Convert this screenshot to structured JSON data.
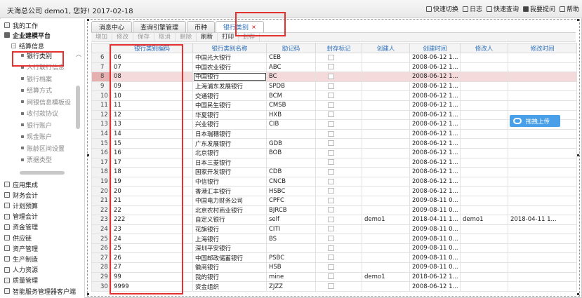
{
  "header": {
    "greeting": "天海总公司 demo1, 您好! 2017-02-18",
    "links": [
      {
        "icon": "quick-switch-icon",
        "label": "快速切换"
      },
      {
        "icon": "log-icon",
        "label": "日志"
      },
      {
        "icon": "quick-query-icon",
        "label": "快速查询"
      },
      {
        "icon": "ask-question-icon",
        "label": "我要提问"
      },
      {
        "icon": "help-icon",
        "label": "帮助"
      }
    ]
  },
  "sidebar": {
    "my_work": "我的工作",
    "enterprise": "企业建模平台",
    "settlement": "结算信息",
    "settlement_items": [
      "银行类别",
      "人行联行信息",
      "银行档案",
      "结算方式",
      "网银信息模板设",
      "收付款协议",
      "银行账户",
      "现金账户",
      "账龄区间设置",
      "票据类型"
    ],
    "active_item": "银行类别",
    "modules": [
      "应用集成",
      "财务会计",
      "计划预算",
      "管理会计",
      "资金管理",
      "供应链",
      "资产管理",
      "生产制造",
      "人力资源",
      "质量管理",
      "智能服务管理器客户端"
    ]
  },
  "tabs": [
    {
      "label": "消息中心"
    },
    {
      "label": "查询引擎管理"
    },
    {
      "label": "币种"
    },
    {
      "label": "银行类别",
      "close": "×"
    }
  ],
  "toolbar": [
    "增加",
    "修改",
    "保存",
    "取消",
    "删除",
    "刷新",
    "打印",
    "封存"
  ],
  "toolbar_enabled": [
    false,
    false,
    false,
    false,
    false,
    true,
    true,
    false
  ],
  "table": {
    "columns": [
      "",
      "银行类别编码",
      "银行类别名称",
      "助记码",
      "封存标记",
      "创建人",
      "创建时间",
      "修改人",
      "修改时间"
    ],
    "selected_row": 8,
    "rows": [
      {
        "n": "6",
        "code": "06",
        "name": "中国光大银行",
        "mnem": "CEB",
        "creator": "",
        "ctime": "2008-06-12 1...",
        "modifier": "",
        "mtime": ""
      },
      {
        "n": "7",
        "code": "07",
        "name": "中国农业银行",
        "mnem": "ABC",
        "creator": "",
        "ctime": "2008-06-12 1...",
        "modifier": "",
        "mtime": ""
      },
      {
        "n": "8",
        "code": "08",
        "name": "中国银行",
        "mnem": "BC",
        "creator": "",
        "ctime": "2008-06-12 1...",
        "modifier": "",
        "mtime": ""
      },
      {
        "n": "9",
        "code": "09",
        "name": "上海浦东发展银行",
        "mnem": "SPDB",
        "creator": "",
        "ctime": "2008-06-12 1...",
        "modifier": "",
        "mtime": ""
      },
      {
        "n": "10",
        "code": "10",
        "name": "交通银行",
        "mnem": "BCM",
        "creator": "",
        "ctime": "2008-06-12 1...",
        "modifier": "",
        "mtime": ""
      },
      {
        "n": "11",
        "code": "11",
        "name": "中国民生银行",
        "mnem": "CMSB",
        "creator": "",
        "ctime": "2008-06-12 1...",
        "modifier": "",
        "mtime": ""
      },
      {
        "n": "12",
        "code": "12",
        "name": "华夏银行",
        "mnem": "HXB",
        "creator": "",
        "ctime": "2008-06-12 1...",
        "modifier": "",
        "mtime": ""
      },
      {
        "n": "13",
        "code": "13",
        "name": "兴业银行",
        "mnem": "CIB",
        "creator": "",
        "ctime": "2008-06-12 1...",
        "modifier": "",
        "mtime": ""
      },
      {
        "n": "14",
        "code": "14",
        "name": "日本瑞穗银行",
        "mnem": "",
        "creator": "",
        "ctime": "2008-06-12 1...",
        "modifier": "",
        "mtime": ""
      },
      {
        "n": "15",
        "code": "15",
        "name": "广东发展银行",
        "mnem": "GDB",
        "creator": "",
        "ctime": "2008-06-12 1...",
        "modifier": "",
        "mtime": ""
      },
      {
        "n": "16",
        "code": "16",
        "name": "北京银行",
        "mnem": "BOB",
        "creator": "",
        "ctime": "2008-06-12 1...",
        "modifier": "",
        "mtime": ""
      },
      {
        "n": "17",
        "code": "17",
        "name": "日本三菱银行",
        "mnem": "",
        "creator": "",
        "ctime": "2008-06-12 1...",
        "modifier": "",
        "mtime": ""
      },
      {
        "n": "18",
        "code": "18",
        "name": "国家开发银行",
        "mnem": "CDB",
        "creator": "",
        "ctime": "2008-06-12 1...",
        "modifier": "",
        "mtime": ""
      },
      {
        "n": "19",
        "code": "19",
        "name": "中信银行",
        "mnem": "CNCB",
        "creator": "",
        "ctime": "2008-06-12 1...",
        "modifier": "",
        "mtime": ""
      },
      {
        "n": "20",
        "code": "20",
        "name": "香港汇丰银行",
        "mnem": "HSBC",
        "creator": "",
        "ctime": "2008-06-12 1...",
        "modifier": "",
        "mtime": ""
      },
      {
        "n": "21",
        "code": "21",
        "name": "中国电力财务公司",
        "mnem": "CPFC",
        "creator": "",
        "ctime": "2009-08-11 0...",
        "modifier": "",
        "mtime": ""
      },
      {
        "n": "22",
        "code": "22",
        "name": "北京农村商业银行",
        "mnem": "BJRCB",
        "creator": "",
        "ctime": "2009-08-11 0...",
        "modifier": "",
        "mtime": ""
      },
      {
        "n": "23",
        "code": "222",
        "name": "自定义银行",
        "mnem": "self",
        "creator": "demo1",
        "ctime": "2018-04-11 1...",
        "modifier": "demo1",
        "mtime": "2018-04-11 1..."
      },
      {
        "n": "24",
        "code": "23",
        "name": "花旗银行",
        "mnem": "CITI",
        "creator": "",
        "ctime": "2009-08-11 0...",
        "modifier": "",
        "mtime": ""
      },
      {
        "n": "25",
        "code": "24",
        "name": "上海银行",
        "mnem": "BS",
        "creator": "",
        "ctime": "2009-08-11 0...",
        "modifier": "",
        "mtime": ""
      },
      {
        "n": "26",
        "code": "25",
        "name": "深圳平安银行",
        "mnem": "",
        "creator": "",
        "ctime": "2009-08-11 0...",
        "modifier": "",
        "mtime": ""
      },
      {
        "n": "27",
        "code": "26",
        "name": "中国邮政储蓄银行",
        "mnem": "PSBC",
        "creator": "",
        "ctime": "2009-08-11 0...",
        "modifier": "",
        "mtime": ""
      },
      {
        "n": "28",
        "code": "27",
        "name": "徽商银行",
        "mnem": "HSB",
        "creator": "",
        "ctime": "2009-08-11 0...",
        "modifier": "",
        "mtime": ""
      },
      {
        "n": "29",
        "code": "99",
        "name": "我的银行",
        "mnem": "mine",
        "creator": "demo1",
        "ctime": "2018-06-12 1...",
        "modifier": "",
        "mtime": ""
      },
      {
        "n": "30",
        "code": "9999",
        "name": "资金组织",
        "mnem": "ZJZZ",
        "creator": "",
        "ctime": "2008-06-12 1...",
        "modifier": "",
        "mtime": ""
      }
    ]
  },
  "upload_badge": "拖拽上传",
  "colors": {
    "accent": "#2a6ebb",
    "annotation": "#e53030",
    "selected_row": "#f4dada",
    "upload": "#4aa0e8"
  }
}
